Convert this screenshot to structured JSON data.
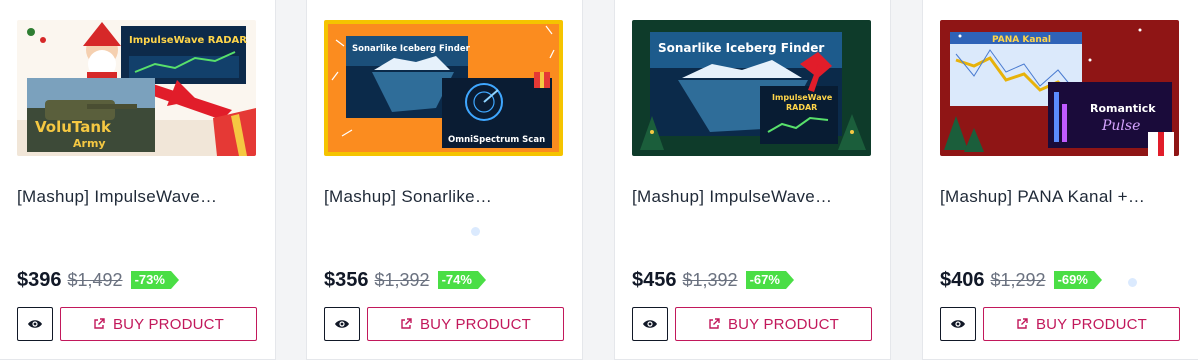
{
  "products": [
    {
      "title": "[Mashup] ImpulseWave…",
      "price": "$396",
      "old_price": "$1,492",
      "discount": "-73%",
      "image_text": [
        "ImpulseWave RADAR",
        "VoluTank",
        "Army"
      ]
    },
    {
      "title": "[Mashup] Sonarlike…",
      "price": "$356",
      "old_price": "$1,392",
      "discount": "-74%",
      "image_text": [
        "Sonarlike Iceberg Finder",
        "OmniSpectrum Scan"
      ]
    },
    {
      "title": "[Mashup] ImpulseWave…",
      "price": "$456",
      "old_price": "$1,392",
      "discount": "-67%",
      "image_text": [
        "Sonarlike Iceberg Finder",
        "ImpulseWave",
        "RADAR"
      ]
    },
    {
      "title": "[Mashup] PANA Kanal +…",
      "price": "$406",
      "old_price": "$1,292",
      "discount": "-69%",
      "image_text": [
        "PANA Kanal",
        "Romantick",
        "Pulse"
      ]
    }
  ],
  "buy_label": "BUY PRODUCT",
  "icons": {
    "view": "eye-icon",
    "buy": "external-link-icon"
  },
  "colors": {
    "accent": "#c2185b",
    "discount": "#4ade45",
    "text": "#111827"
  }
}
